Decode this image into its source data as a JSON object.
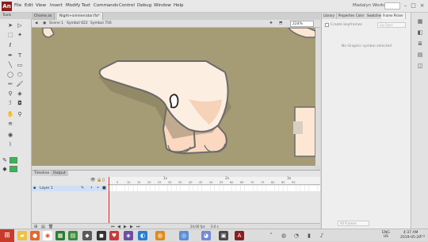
{
  "app": {
    "logo_text": "An"
  },
  "menu": [
    "File",
    "Edit",
    "View",
    "Insert",
    "Modify",
    "Text",
    "Commands",
    "Control",
    "Debug",
    "Window",
    "Help"
  ],
  "workspace": "Madalyn Workspace ▾",
  "doc_tabs": [
    "Chome.as",
    "Night+simmerator.fla*"
  ],
  "breadcrumbs": [
    "Scene 1",
    "Symbol 622",
    "Symbol 756"
  ],
  "zoom": "224%",
  "timeline": {
    "tabs": [
      "Timeline",
      "Output"
    ],
    "seconds": [
      "1s",
      "2s",
      "3s"
    ],
    "frame_numbers": [
      "5",
      "10",
      "15",
      "20",
      "25",
      "30",
      "35",
      "40",
      "45",
      "50",
      "55",
      "60",
      "65",
      "70",
      "75",
      "80",
      "85",
      "90"
    ],
    "layer_name": "Layer 1",
    "fps": "24.00 fps",
    "time": "0.0 s"
  },
  "right_panel": {
    "tabs": [
      "Library",
      "Properties",
      "Color",
      "Swatches",
      "Frame Picker"
    ],
    "checkbox_label": "Create keyframes",
    "dropdown": "Lip Sync",
    "message": "No Graphic symbol selected",
    "bottom_dropdown": "All Frames"
  },
  "tray": {
    "lang": "ENG",
    "region": "US",
    "time": "4:37 AM",
    "date": "2019-05-20"
  },
  "colors": {
    "stage": "#a59c76",
    "stroke": "#2ebd4f",
    "fill": "#2ebd4f"
  }
}
